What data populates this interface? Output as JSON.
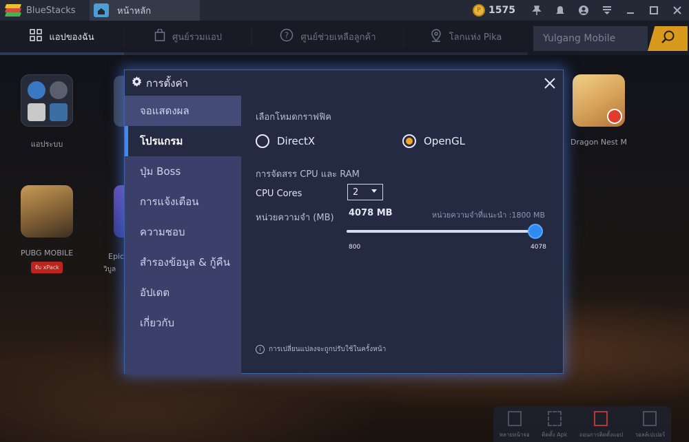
{
  "app": {
    "brand_name": "BlueStacks",
    "home_tab_label": "หน้าหลัก",
    "coins": "1575"
  },
  "nav": {
    "tabs": [
      {
        "label": "แอปของฉัน",
        "icon": "grid-icon"
      },
      {
        "label": "ศูนย์รวมแอป",
        "icon": "shopping-bag-icon"
      },
      {
        "label": "ศูนย์ช่วยเหลือลูกค้า",
        "icon": "help-circle-icon"
      },
      {
        "label": "โลกแห่ง Pika",
        "icon": "map-pin-icon"
      }
    ],
    "search_value": "Yulgang Mobile"
  },
  "desktop": {
    "apps": [
      {
        "label": "แอประบบ"
      },
      {
        "label": "PUBG MOBILE",
        "badge": "จับ xPack"
      },
      {
        "label": "Epic"
      },
      {
        "label": "วิบูล"
      },
      {
        "label": "Dragon Nest M"
      }
    ],
    "dock": [
      {
        "label": "หลายหน้าจอ"
      },
      {
        "label": "ติดตั้ง Apk"
      },
      {
        "label": "ถอนการติดตั้งแอป"
      },
      {
        "label": "วอลล์เปเปอร์"
      }
    ]
  },
  "settings": {
    "title": "การตั้งค่า",
    "sidebar": [
      {
        "label": "จอแสดงผล"
      },
      {
        "label": "โปรแกรม"
      },
      {
        "label": "ปุ่ม Boss"
      },
      {
        "label": "การแจ้งเตือน"
      },
      {
        "label": "ความชอบ"
      },
      {
        "label": "สำรองข้อมูล & กู้คืน"
      },
      {
        "label": "อัปเดต"
      },
      {
        "label": "เกี่ยวกับ"
      }
    ],
    "graphics": {
      "section_title": "เลือกโหมดกราฟฟิค",
      "options": [
        "DirectX",
        "OpenGL"
      ],
      "selected": "OpenGL"
    },
    "resources": {
      "section_title": "การจัดสรร CPU และ RAM",
      "cpu_label": "CPU Cores",
      "cpu_value": "2",
      "memory_label": "หน่วยความจำ (MB)",
      "memory_value": "4078 MB",
      "recommended": "หน่วยความจำที่แนะนำ :1800 MB",
      "slider_min": "800",
      "slider_max": "4078",
      "slider_fraction": 1.0
    },
    "note": "การเปลี่ยนแปลงจะถูกปรับใช้ในครั้งหน้า"
  },
  "colors": {
    "accent_blue": "#2f8bf0",
    "accent_orange": "#f2a52a",
    "modal_bg": "#252a43",
    "sidebar_bg": "#3a4069"
  }
}
